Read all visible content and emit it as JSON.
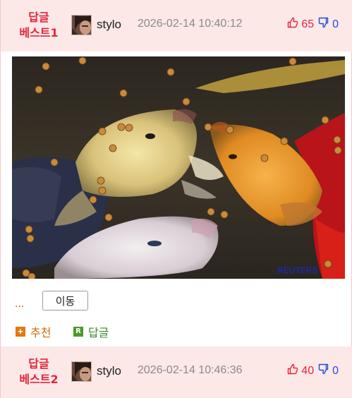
{
  "posts": [
    {
      "badge_line1": "답글",
      "badge_line2": "베스트1",
      "username": "stylo",
      "timestamp": "2026-02-14 10:40:12",
      "upvotes": "65",
      "downvotes": "0"
    },
    {
      "badge_line1": "답글",
      "badge_line2": "베스트2",
      "username": "stylo",
      "timestamp": "2026-02-14 10:46:36",
      "upvotes": "40",
      "downvotes": "0"
    }
  ],
  "image": {
    "watermark": "REUTERS"
  },
  "actions": {
    "more": "...",
    "move_label": "이동",
    "recommend_icon": "+",
    "recommend_label": "추천",
    "reply_icon": "R",
    "reply_label": "답글"
  },
  "colors": {
    "header_bg": "#fde8e8",
    "badge": "#e0263b",
    "upvote": "#e0263b",
    "downvote": "#1e4fd6"
  }
}
